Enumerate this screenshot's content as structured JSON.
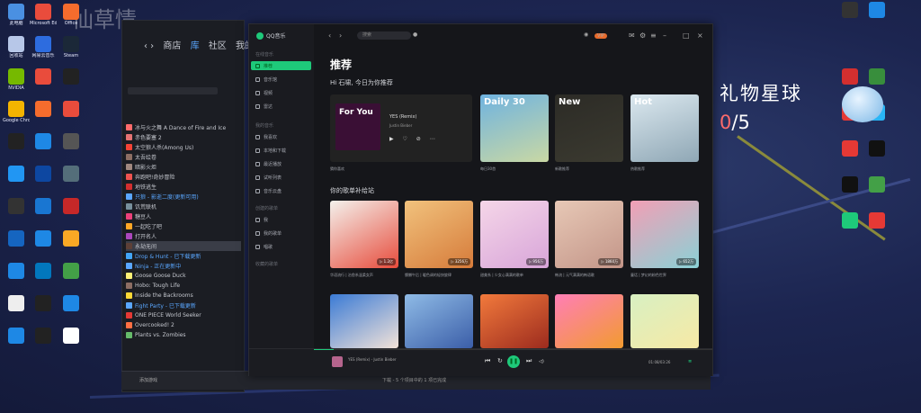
{
  "watermark": "仙草情",
  "desktop_left": [
    {
      "label": "此电脑",
      "color": "#4a90e2"
    },
    {
      "label": "Microsoft Edge",
      "color": "#e94c3c"
    },
    {
      "label": "Office",
      "color": "#f56c2d"
    },
    {
      "label": "回收站",
      "color": "#b7c7e8"
    },
    {
      "label": "网易云音乐",
      "color": "#2d6cdf"
    },
    {
      "label": "Steam",
      "color": "#1b2838"
    },
    {
      "label": "NVIDIA",
      "color": "#76b900"
    },
    {
      "label": "",
      "color": "#e94c3c"
    },
    {
      "label": "",
      "color": "#222"
    },
    {
      "label": "Google Chrome",
      "color": "#f4b400"
    },
    {
      "label": "",
      "color": "#f56c2d"
    },
    {
      "label": "",
      "color": "#e94c3c"
    },
    {
      "label": "",
      "color": "#222"
    },
    {
      "label": "",
      "color": "#1e88e5"
    },
    {
      "label": "",
      "color": "#555"
    },
    {
      "label": "",
      "color": "#2196f3"
    },
    {
      "label": "",
      "color": "#0d47a1"
    },
    {
      "label": "",
      "color": "#546e7a"
    },
    {
      "label": "",
      "color": "#333"
    },
    {
      "label": "",
      "color": "#1976d2"
    },
    {
      "label": "",
      "color": "#c62828"
    },
    {
      "label": "",
      "color": "#1565c0"
    },
    {
      "label": "",
      "color": "#1e88e5"
    },
    {
      "label": "",
      "color": "#f9a825"
    },
    {
      "label": "",
      "color": "#1e88e5"
    },
    {
      "label": "",
      "color": "#0277bd"
    },
    {
      "label": "",
      "color": "#43a047"
    },
    {
      "label": "",
      "color": "#eee"
    },
    {
      "label": "",
      "color": "#222"
    },
    {
      "label": "",
      "color": "#1e88e5"
    },
    {
      "label": "",
      "color": "#1e88e5"
    },
    {
      "label": "",
      "color": "#222"
    },
    {
      "label": "",
      "color": "#fff"
    }
  ],
  "desktop_right": [
    {
      "color": "#333"
    },
    {
      "color": "#1e88e5"
    },
    {
      "color": "#d32f2f"
    },
    {
      "color": "#388e3c"
    },
    {
      "color": "#e53935"
    },
    {
      "color": "#29b6f6"
    },
    {
      "color": "#e53935"
    },
    {
      "color": "#111"
    },
    {
      "color": "#111"
    },
    {
      "color": "#43a047"
    },
    {
      "color": "#1ec97a"
    },
    {
      "color": "#e53935"
    }
  ],
  "game_window": {
    "nav": [
      "商店",
      "库",
      "社区",
      "我的"
    ],
    "games": [
      {
        "name": "冰与火之舞 A Dance of Fire and Ice",
        "color": "#ff6b6b"
      },
      {
        "name": "赤色要塞 2",
        "color": "#e57373"
      },
      {
        "name": "太空狼人杀(Among Us)",
        "color": "#f44336"
      },
      {
        "name": "太吾绘卷",
        "color": "#8d6e63"
      },
      {
        "name": "暗影火炬",
        "color": "#a1887f"
      },
      {
        "name": "奔跑吧!奇妙冒险",
        "color": "#ef5350"
      },
      {
        "name": "地铁逃生",
        "color": "#d32f2f"
      },
      {
        "name": "只狼 - 影逝二度(更新可用)",
        "color": "#5aa7ff",
        "update": true
      },
      {
        "name": "饥荒联机",
        "color": "#78909c"
      },
      {
        "name": "糖豆人",
        "color": "#ec407a"
      },
      {
        "name": "一起吃了吧",
        "color": "#ffa726"
      },
      {
        "name": "打开名人",
        "color": "#ab47bc"
      },
      {
        "name": "永劫无间",
        "color": "#5d4037",
        "selected": true
      },
      {
        "name": "Drop & Hunt - 已下载更新",
        "color": "#42a5f5",
        "update": true
      },
      {
        "name": "Ninja - 正在更新中",
        "color": "#5aa7ff",
        "update": true
      },
      {
        "name": "Goose Goose Duck",
        "color": "#fff176"
      },
      {
        "name": "Hobo: Tough Life",
        "color": "#8d6e63"
      },
      {
        "name": "Inside the Backrooms",
        "color": "#fdd835"
      },
      {
        "name": "Fight Party - 已下载更新",
        "color": "#5aa7ff",
        "update": true
      },
      {
        "name": "ONE PIECE World Seeker",
        "color": "#e53935"
      },
      {
        "name": "Overcooked! 2",
        "color": "#ff7043"
      },
      {
        "name": "Plants vs. Zombies",
        "color": "#66bb6a"
      }
    ],
    "bottom_left": "添加游戏",
    "bottom_center": "下载 - 5 个项目中的 1 项已完成"
  },
  "music": {
    "logo": "QQ音乐",
    "search_placeholder": "搜索",
    "sidebar": {
      "head_online": "在线音乐",
      "items_top": [
        {
          "label": "推荐",
          "active": true
        },
        {
          "label": "音乐馆"
        },
        {
          "label": "视频"
        },
        {
          "label": "雷达"
        }
      ],
      "head_mine": "我的音乐",
      "items_mine": [
        {
          "label": "我喜欢"
        },
        {
          "label": "本地和下载"
        },
        {
          "label": "最近播放"
        },
        {
          "label": "试听列表"
        },
        {
          "label": "音乐云盘"
        }
      ],
      "head_created": "创建的歌单",
      "items_created": [
        {
          "label": "我"
        },
        {
          "label": "我的歌单"
        },
        {
          "label": "唱歌"
        }
      ],
      "head_collected": "收藏的歌单"
    },
    "title": "推荐",
    "greeting": "Hi 石啸, 今日为你推荐",
    "featured": {
      "tag": "For You",
      "song": "YES (Remix)",
      "artist": "Justin Bieber",
      "controls": "▶ ♡ ⊘ ⋯",
      "caption": "猜你喜欢"
    },
    "daily": [
      {
        "tag": "Daily 30",
        "caption": "每日30首",
        "c1": "#6fb3e0",
        "c2": "#c9d8a4"
      },
      {
        "tag": "New",
        "caption": "新歌推荐",
        "c1": "#2c2b26",
        "c2": "#3b3a30"
      },
      {
        "tag": "Hot",
        "caption": "热歌推荐",
        "c1": "#dbe8ef",
        "c2": "#8fa7b5"
      }
    ],
    "section2": "你的歌单补给站",
    "playlists": [
      {
        "count": "▷ 1.2亿",
        "caption": "华语流行 | 治愈系温柔女声",
        "c1": "#f4f1ec",
        "c2": "#e74c3c"
      },
      {
        "count": "▷ 3256万",
        "caption": "慵懒午后 | 暖色调的轻快旋律",
        "c1": "#f1c27d",
        "c2": "#d67b3a"
      },
      {
        "count": "▷ 956万",
        "caption": "甜美系 | 少女心满满的歌单",
        "c1": "#f5d6e8",
        "c2": "#d8a5d9"
      },
      {
        "count": "▷ 1860万",
        "caption": "韩流 | 元气满满的韩语歌",
        "c1": "#e7c8b6",
        "c2": "#c39588"
      },
      {
        "count": "▷ 652万",
        "caption": "童话 | 梦幻的粉色世界",
        "c1": "#f29fb5",
        "c2": "#8ad1d6"
      },
      {
        "count": "",
        "caption": "",
        "c1": "#3b7bd6",
        "c2": "#f3e3d8"
      },
      {
        "count": "",
        "caption": "",
        "c1": "#8fbbe6",
        "c2": "#3b5ea8"
      },
      {
        "count": "",
        "caption": "",
        "c1": "#f27a3c",
        "c2": "#9c2b1e"
      },
      {
        "count": "",
        "caption": "",
        "c1": "#ff7eb6",
        "c2": "#f29b2f"
      },
      {
        "count": "",
        "caption": "",
        "c1": "#d8f0c2",
        "c2": "#f7e9a5"
      }
    ],
    "player": {
      "meta": "YES (Remix) - Justin Bieber",
      "time": "01:08/03:26",
      "progress": 0.05
    }
  },
  "gift": {
    "title": "礼物星球",
    "current": "0",
    "total": "/5"
  }
}
